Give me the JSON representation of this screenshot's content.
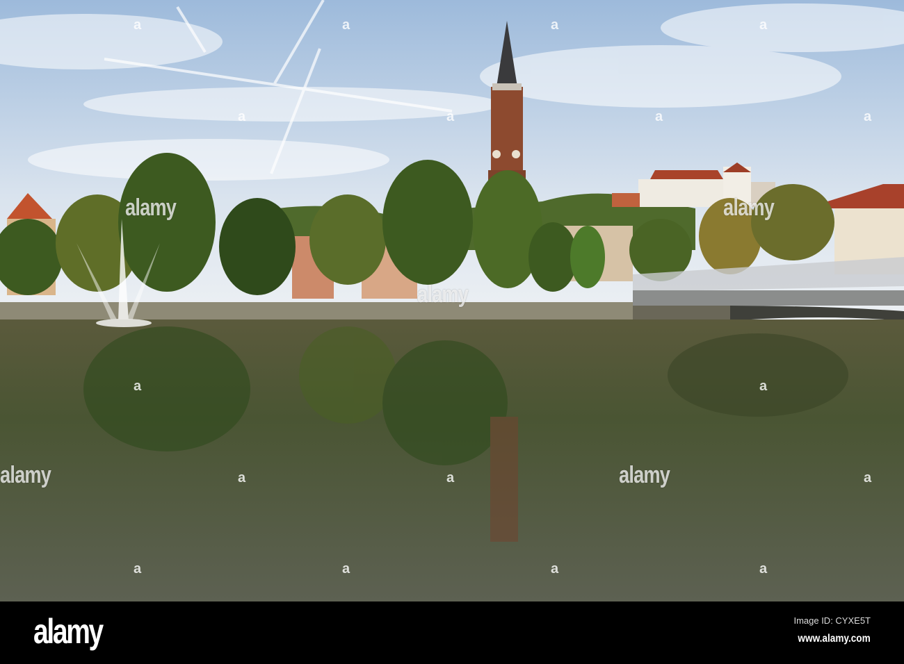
{
  "photo": {
    "subject": "River with fountain, church tower, castle on hill and bridge",
    "colors": {
      "sky_top": "#a9c3e0",
      "sky_bottom": "#e6edf3",
      "water": "#4d5236",
      "tree": "#3f5a22",
      "tower": "#8a4a30",
      "castle": "#f0ece4",
      "roof": "#b5452c"
    }
  },
  "watermark": {
    "text": "alamy",
    "mark": "a"
  },
  "footer": {
    "logo": "alamy",
    "image_id": "Image ID: CYXE5T",
    "website": "www.alamy.com"
  }
}
